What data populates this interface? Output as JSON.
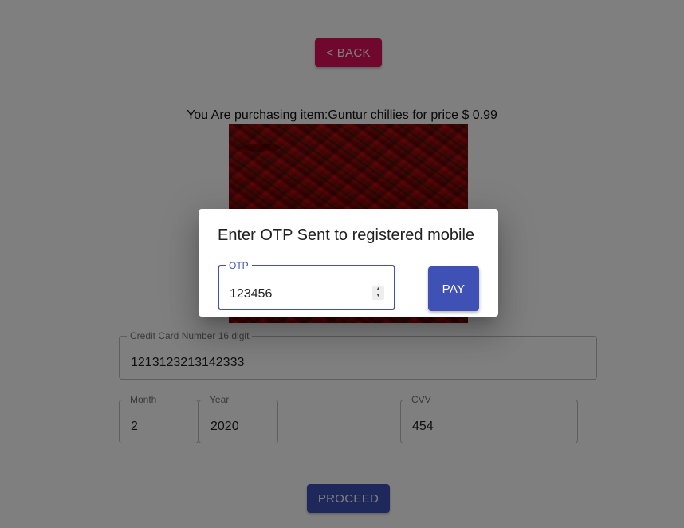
{
  "page": {
    "back_label": "< BACK",
    "purchase_text": "You Are purchasing item:Guntur chillies for price $ 0.99",
    "product_image": "guntur-chillies-photo",
    "proceed_label": "PROCEED"
  },
  "form": {
    "card_number": {
      "label": "Credit Card Number 16 digit",
      "value": "1213123213142333"
    },
    "month": {
      "label": "Month",
      "value": "2"
    },
    "year": {
      "label": "Year",
      "value": "2020"
    },
    "cvv": {
      "label": "CVV",
      "value": "454"
    }
  },
  "dialog": {
    "title": "Enter OTP Sent to registered mobile",
    "otp_label": "OTP",
    "otp_value": "123456",
    "pay_label": "PAY"
  },
  "colors": {
    "back_button": "#e0105a",
    "primary": "#3f51b5",
    "overlay": "rgba(0,0,0,0.5)"
  }
}
